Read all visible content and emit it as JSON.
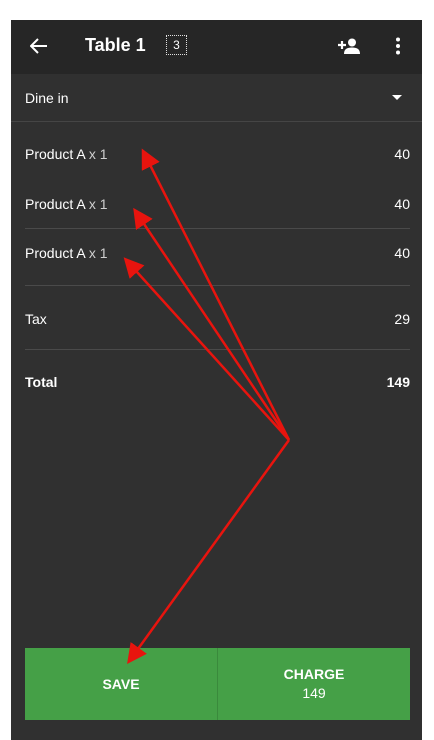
{
  "appbar": {
    "title": "Table 1",
    "guest_count": "3",
    "icons": {
      "back": "arrow-back-icon",
      "add_customer": "person-add-icon",
      "overflow": "more-vert-icon"
    }
  },
  "dining_option": {
    "selected": "Dine in",
    "icon": "dropdown-arrow-icon"
  },
  "ticket": {
    "items": [
      {
        "name": "Product A",
        "qty": "x 1",
        "amount": "40"
      },
      {
        "name": "Product A",
        "qty": "x 1",
        "amount": "40"
      },
      {
        "name": "Product A",
        "qty": "x 1",
        "amount": "40"
      }
    ],
    "tax": {
      "label": "Tax",
      "value": "29"
    },
    "total": {
      "label": "Total",
      "value": "149"
    }
  },
  "actions": {
    "save_label": "SAVE",
    "charge_label": "CHARGE",
    "charge_amount": "149"
  },
  "colors": {
    "background": "#303030",
    "appbar": "#262626",
    "button": "#45a047",
    "annotation_arrows": "#e8140e"
  }
}
